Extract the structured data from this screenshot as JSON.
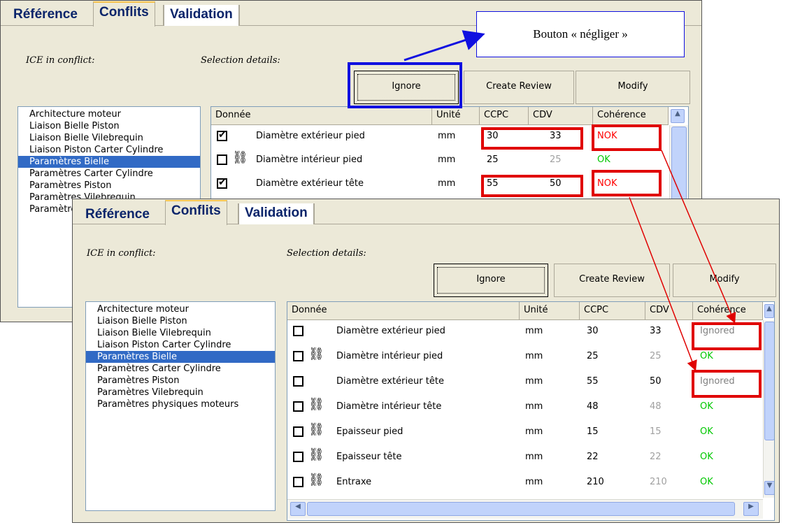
{
  "tabs": [
    "Référence",
    "Conflits",
    "Validation"
  ],
  "labels": {
    "ice": "ICE in conflict:",
    "details": "Selection details:"
  },
  "buttons": {
    "ignore": "Ignore",
    "review": "Create Review",
    "modify": "Modify"
  },
  "callout": "Bouton « négliger »",
  "headers": [
    "Donnée",
    "Unité",
    "CCPC",
    "CDV",
    "Cohérence"
  ],
  "ice_list": [
    "Architecture moteur",
    "Liaison Bielle Piston",
    "Liaison Bielle Vilebrequin",
    "Liaison Piston Carter Cylindre",
    "Paramètres Bielle",
    "Paramètres Carter Cylindre",
    "Paramètres Piston",
    "Paramètres Vilebrequin",
    "Paramètres physiques moteurs"
  ],
  "ice_list_truncated": [
    "Paramètres Piston",
    "Paramèt",
    "Paramèt"
  ],
  "selected_index": 4,
  "back_rows": [
    {
      "checked": true,
      "chain": false,
      "name": "Diamètre extérieur pied",
      "unit": "mm",
      "ccpc": "30",
      "cdv": "33",
      "status": "NOK"
    },
    {
      "checked": false,
      "chain": true,
      "name": "Diamètre intérieur pied",
      "unit": "mm",
      "ccpc": "25",
      "cdv": "25",
      "status": "OK"
    },
    {
      "checked": true,
      "chain": false,
      "name": "Diamètre extérieur tête",
      "unit": "mm",
      "ccpc": "55",
      "cdv": "50",
      "status": "NOK"
    }
  ],
  "front_rows": [
    {
      "checked": false,
      "chain": false,
      "name": "Diamètre extérieur pied",
      "unit": "mm",
      "ccpc": "30",
      "cdv": "33",
      "status": "Ignored"
    },
    {
      "checked": false,
      "chain": true,
      "name": "Diamètre intérieur pied",
      "unit": "mm",
      "ccpc": "25",
      "cdv": "25",
      "status": "OK"
    },
    {
      "checked": false,
      "chain": false,
      "name": "Diamètre extérieur tête",
      "unit": "mm",
      "ccpc": "55",
      "cdv": "50",
      "status": "Ignored"
    },
    {
      "checked": false,
      "chain": true,
      "name": "Diamètre intérieur tête",
      "unit": "mm",
      "ccpc": "48",
      "cdv": "48",
      "status": "OK"
    },
    {
      "checked": false,
      "chain": true,
      "name": "Epaisseur pied",
      "unit": "mm",
      "ccpc": "15",
      "cdv": "15",
      "status": "OK"
    },
    {
      "checked": false,
      "chain": true,
      "name": "Epaisseur tête",
      "unit": "mm",
      "ccpc": "22",
      "cdv": "22",
      "status": "OK"
    },
    {
      "checked": false,
      "chain": true,
      "name": "Entraxe",
      "unit": "mm",
      "ccpc": "210",
      "cdv": "210",
      "status": "OK"
    }
  ],
  "colors": {
    "highlight": "#e00000",
    "callout_border": "#1010e0",
    "selection": "#316ac5",
    "ok": "#00c800",
    "nok": "#ff0000",
    "ignored": "#808080"
  }
}
